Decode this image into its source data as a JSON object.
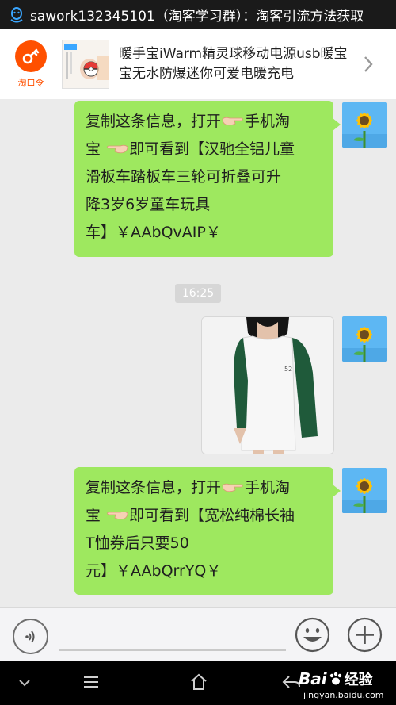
{
  "status_bar": {
    "title": "sawork132345101（淘客学习群）：淘客引流方法获取"
  },
  "banner": {
    "logo_label": "淘口令",
    "product_title": "暖手宝iWarm精灵球移动电源usb暖宝宝无水防爆迷你可爱电暖充电"
  },
  "messages": [
    {
      "lines": [
        "复制这条信息，打开",
        "手机淘",
        "宝 ",
        "即可看到【汉驰全铝儿童",
        "滑板车踏板车三轮可折叠可升",
        "降3岁6岁童车玩具",
        "车】￥AAbQvAIP￥"
      ]
    },
    {
      "lines": [
        "复制这条信息，打开",
        "手机淘",
        "宝 ",
        "即可看到【宽松纯棉长袖",
        "T恤券后只要50",
        "元】￥AAbQrrYQ￥"
      ]
    }
  ],
  "time_label": "16:25",
  "icons": {
    "status": "qq-icon",
    "banner_logo": "key-icon",
    "banner_arrow": "chevron-right-icon",
    "hand": "pointing-hand-icon",
    "voice": "voice-icon",
    "emoji": "smiley-icon",
    "plus": "plus-icon",
    "nav_down": "chevron-down-icon",
    "nav_menu": "menu-icon",
    "nav_home": "home-icon",
    "nav_back": "back-icon",
    "avatar": "sunflower-avatar"
  },
  "watermark": {
    "brand": "Bai",
    "brand_suffix": "经验",
    "url": "jingyan.baidu.com"
  },
  "colors": {
    "bubble": "#9ee85f",
    "accent": "#ff5000",
    "chat_bg": "#ebebeb"
  }
}
